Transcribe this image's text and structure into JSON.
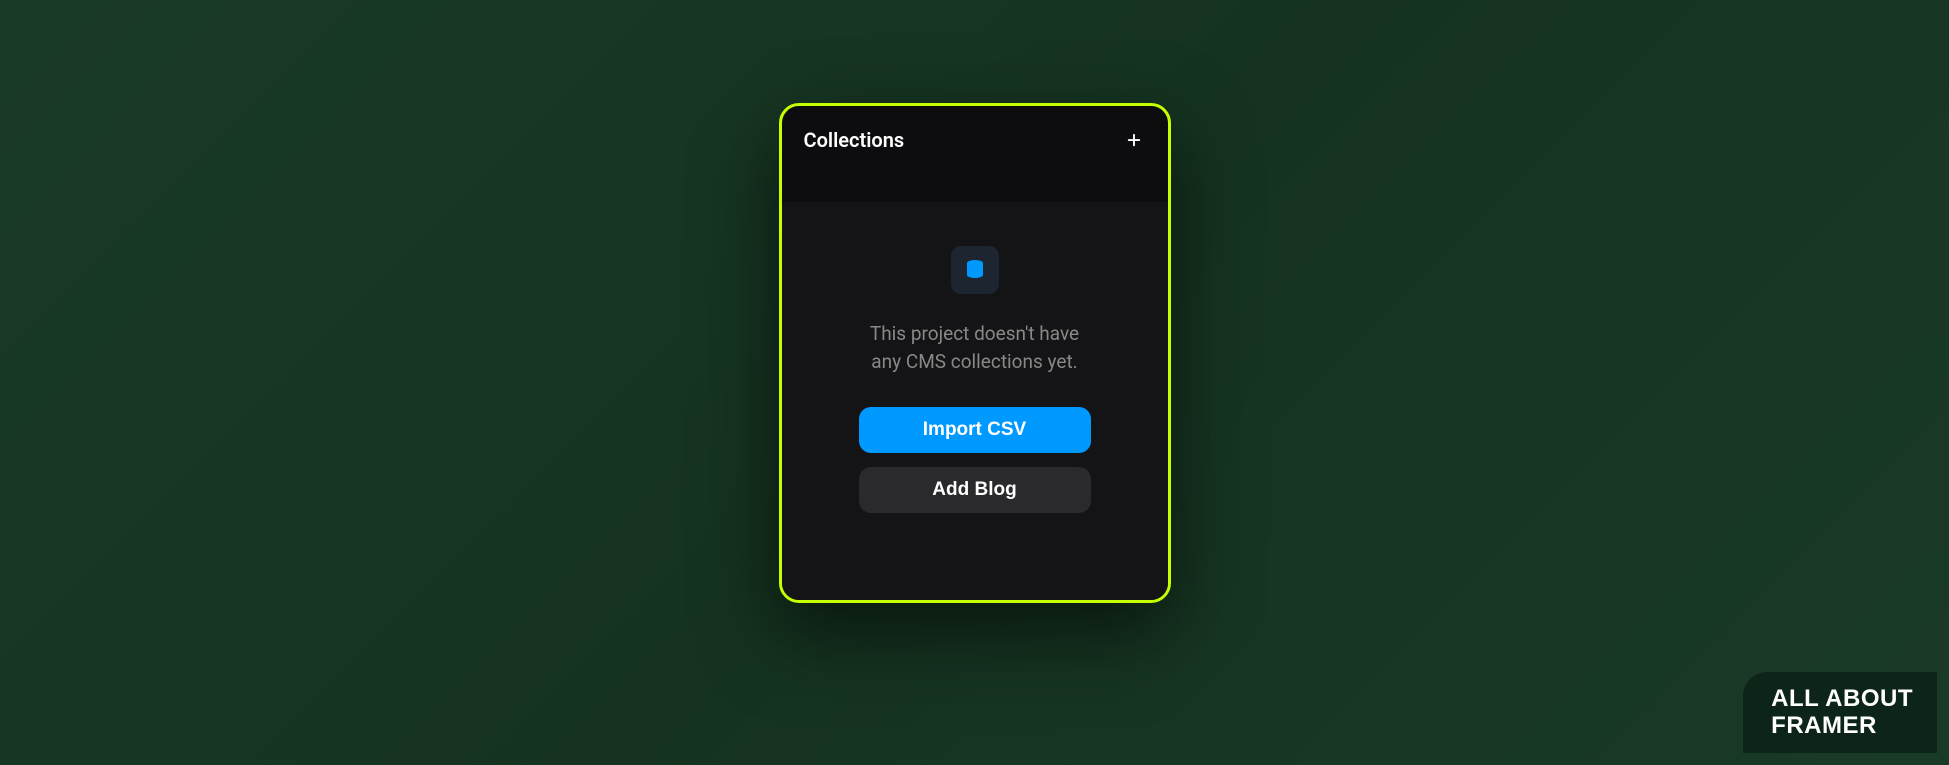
{
  "panel": {
    "title": "Collections",
    "empty_state": {
      "message_line1": "This project doesn't have",
      "message_line2": "any CMS collections yet."
    },
    "buttons": {
      "import_csv": "Import CSV",
      "add_blog": "Add Blog"
    }
  },
  "watermark": {
    "line1": "ALL ABOUT",
    "line2": "FRAMER"
  },
  "colors": {
    "border": "#c6ff00",
    "primary": "#0099ff",
    "background_dark": "#0d0d0f",
    "background_body": "#141416"
  }
}
